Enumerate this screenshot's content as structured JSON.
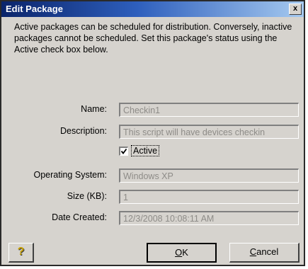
{
  "window": {
    "title": "Edit Package",
    "close_glyph": "x"
  },
  "description": "Active packages can be scheduled for distribution.  Conversely, inactive packages cannot be scheduled.  Set this package's status using the Active check box below.",
  "fields": {
    "name": {
      "label": "Name:",
      "value": "Checkin1"
    },
    "description": {
      "label": "Description:",
      "value": "This script will have devices checkin"
    },
    "active": {
      "label": "Active",
      "checked": true
    },
    "operating_system": {
      "label": "Operating System:",
      "value": "Windows XP"
    },
    "size": {
      "label": "Size (KB):",
      "value": "1"
    },
    "date_created": {
      "label": "Date Created:",
      "value": "12/3/2008 10:08:11 AM"
    }
  },
  "buttons": {
    "help": {
      "icon": "question-mark-icon",
      "glyph": "?"
    },
    "ok": {
      "mnemonic": "O",
      "rest": "K"
    },
    "cancel": {
      "mnemonic": "C",
      "rest": "ancel"
    }
  },
  "colors": {
    "title_start": "#0a246a",
    "title_end": "#a6caf0",
    "dialog_face": "#d6d3ce",
    "disabled_text": "#8e8c88"
  }
}
